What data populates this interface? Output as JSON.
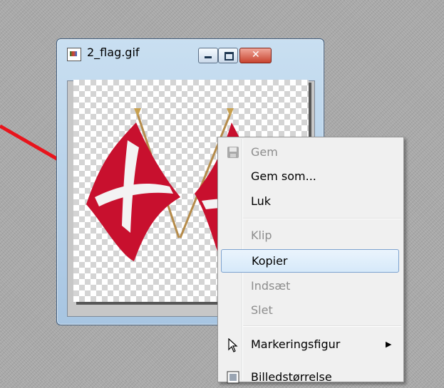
{
  "window": {
    "title": "2_flag.gif",
    "icon": "image-file-icon",
    "buttons": {
      "minimize": "minimize-icon",
      "maximize": "maximize-icon",
      "close": "close-icon"
    }
  },
  "context_menu": {
    "items": [
      {
        "label": "Gem",
        "enabled": false,
        "icon": "save-icon"
      },
      {
        "label": "Gem som...",
        "enabled": true
      },
      {
        "label": "Luk",
        "enabled": true
      },
      {
        "label": "Klip",
        "enabled": false
      },
      {
        "label": "Kopier",
        "enabled": true,
        "highlighted": true
      },
      {
        "label": "Indsæt",
        "enabled": false
      },
      {
        "label": "Slet",
        "enabled": false
      },
      {
        "label": "Markeringsfigur",
        "enabled": true,
        "icon": "pointer-arrow-icon",
        "submenu": true
      },
      {
        "label": "Billedstørrelse",
        "enabled": true,
        "icon": "image-size-icon"
      }
    ]
  },
  "colors": {
    "arrow": "#e8141c",
    "flag_red": "#c8102e",
    "highlight_border": "#7da2ce"
  }
}
